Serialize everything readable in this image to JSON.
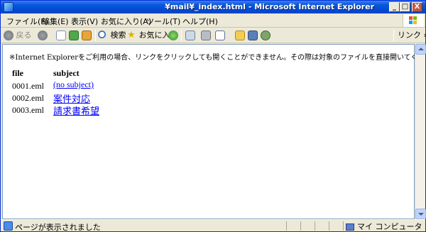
{
  "window": {
    "title": "¥mail¥_index.html - Microsoft Internet Explorer",
    "buttons": {
      "minimize": "_",
      "maximize": "□",
      "close": "X"
    }
  },
  "menubar": {
    "items": [
      {
        "label": "ファイル(F)"
      },
      {
        "label": "編集(E)"
      },
      {
        "label": "表示(V)"
      },
      {
        "label": "お気に入り(A)"
      },
      {
        "label": "ツール(T)"
      },
      {
        "label": "ヘルプ(H)"
      }
    ]
  },
  "toolbar": {
    "back_label": "戻る",
    "search_label": "検索",
    "favorites_label": "お気に入り",
    "links_label": "リンク »",
    "icons": [
      "back-icon",
      "forward-icon",
      "stop-icon",
      "refresh-icon",
      "home-icon",
      "search-icon",
      "favorites-icon",
      "media-icon",
      "mail-icon",
      "print-icon",
      "edit-icon",
      "discuss-icon",
      "research-icon",
      "messenger-icon"
    ]
  },
  "page": {
    "notice": "※Internet Explorerをご利用の場合、リンクをクリックしても開くことができません。その際は対象のファイルを直接開いてください。",
    "headers": {
      "file": "file",
      "subject": "subject"
    },
    "rows": [
      {
        "file": "0001.eml",
        "subject": "(no subject)"
      },
      {
        "file": "0002.eml",
        "subject": "案件対応"
      },
      {
        "file": "0003.eml",
        "subject": "請求書希望"
      }
    ]
  },
  "statusbar": {
    "text": "ページが表示されました",
    "zone": "マイ コンピュータ"
  },
  "colors": {
    "titlebar": "#0a5ade",
    "chrome": "#ece9d8",
    "link": "#0000ff"
  }
}
